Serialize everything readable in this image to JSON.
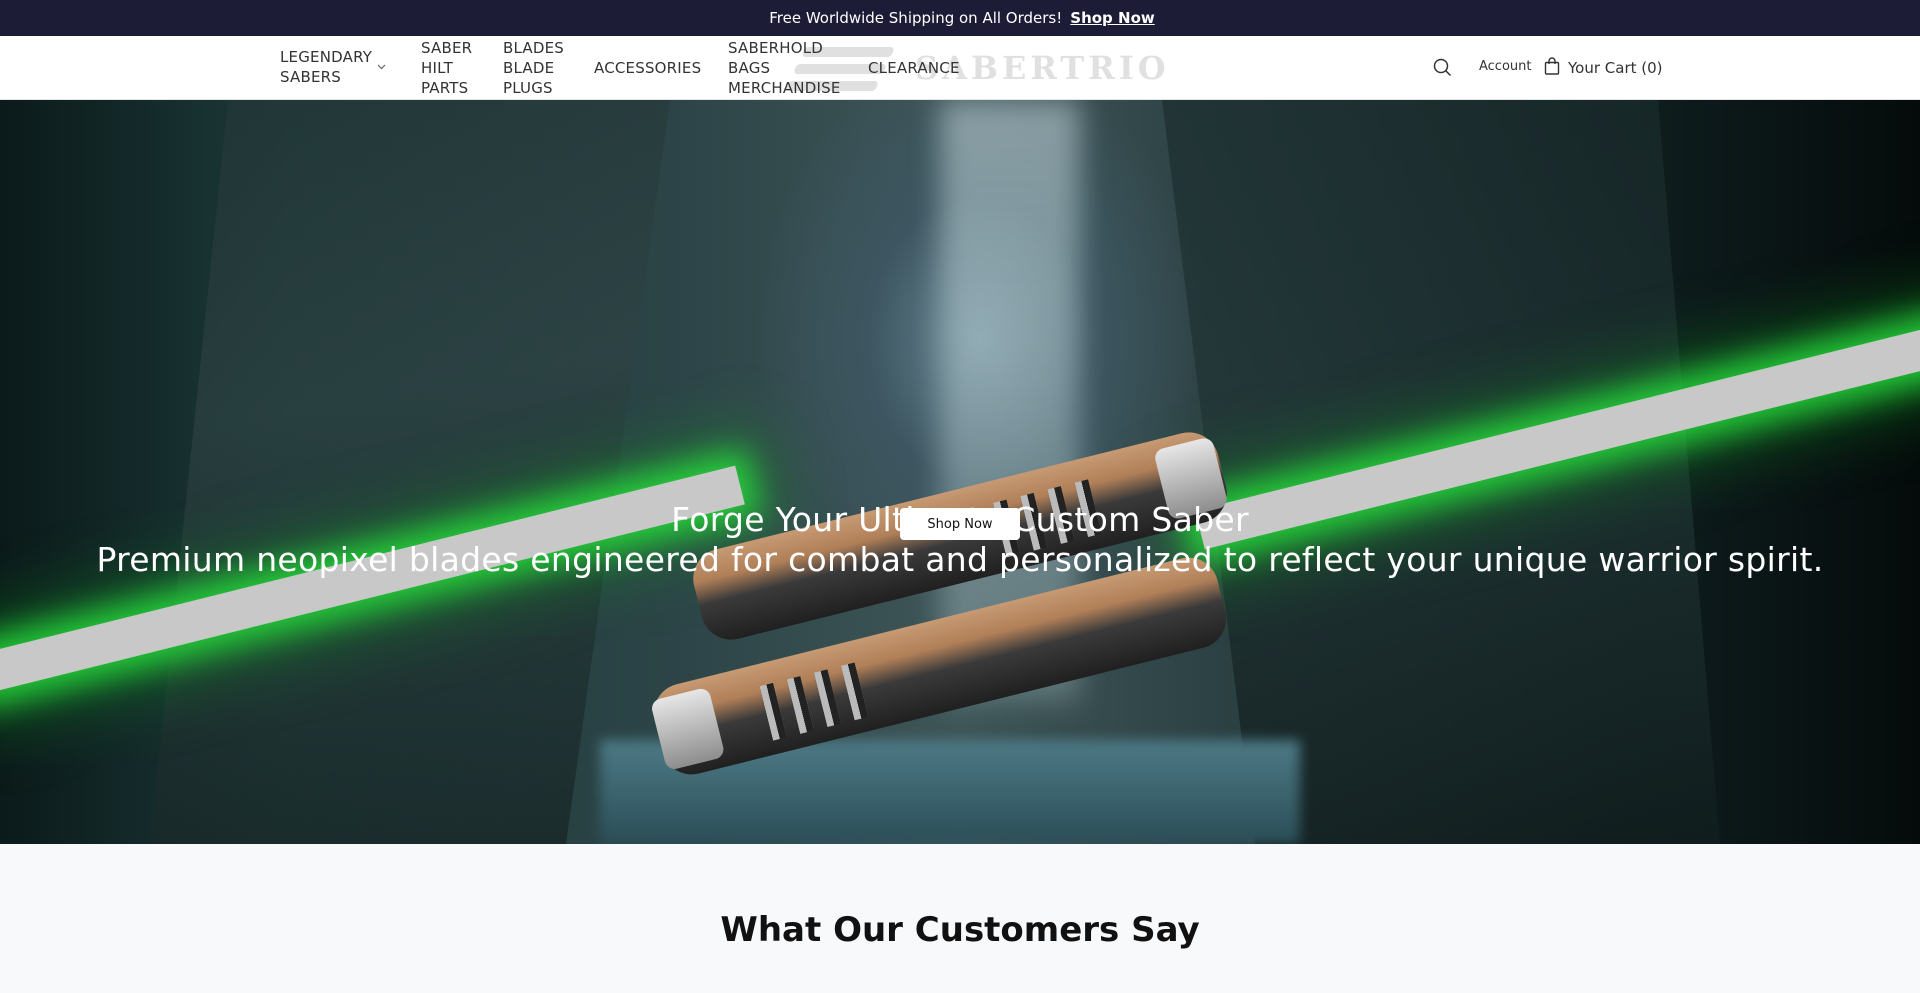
{
  "announcement": {
    "icon": "",
    "message": "Free Worldwide Shipping on All Orders!",
    "link_label": "Shop Now",
    "close_glyph": ""
  },
  "header": {
    "logo_text": "SABERTRIO",
    "nav": {
      "legendary": [
        "LEGENDARY",
        "SABERS"
      ],
      "hilt": [
        "SABER",
        "HILT",
        "PARTS"
      ],
      "blades": [
        "BLADES",
        "BLADE",
        "PLUGS"
      ],
      "accessories": [
        "ACCESSORIES"
      ],
      "saberhold": [
        "SABERHOLD",
        "BAGS",
        "MERCHANDISE"
      ],
      "clearance": [
        "CLEARANCE"
      ]
    },
    "account_label": "Account",
    "cart_label": "Your Cart (0)"
  },
  "hero": {
    "title": "Forge Your Ultimate Custom Saber",
    "subtitle": "Premium neopixel blades engineered for combat and personalized to reflect your unique warrior spirit.",
    "button_label": "Shop Now",
    "blade_glow_color": "#2bdc3c"
  },
  "testimonials": {
    "heading": "What Our Customers Say"
  }
}
